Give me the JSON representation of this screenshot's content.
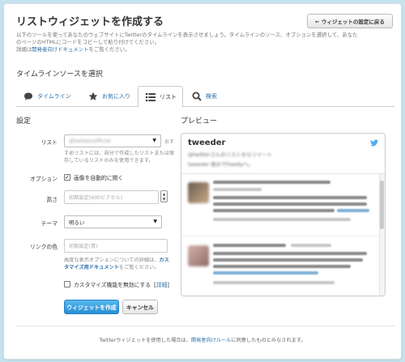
{
  "header": {
    "title": "リストウィジェットを作成する",
    "back_button_label": "← ウィジェットの設定に戻る"
  },
  "intro": {
    "line1": "以下のツールを使ってあなたのウェブサイトにTwitterのタイムラインを表示させましょう。タイムラインのソース、オプションを選択して、あなた",
    "line2": "のページのHTMLにコードをコピーして貼り付けてください。",
    "line3_prefix": "詳細は",
    "line3_link": "開発者向けドキュメント",
    "line3_suffix": "をご覧ください。"
  },
  "source_section_title": "タイムラインソースを選択",
  "tabs": [
    {
      "label": "タイムライン",
      "icon": "speech-bubble-icon"
    },
    {
      "label": "お気に入り",
      "icon": "star-icon"
    },
    {
      "label": "リスト",
      "icon": "list-icon",
      "active": true
    },
    {
      "label": "検索",
      "icon": "search-icon"
    }
  ],
  "settings": {
    "title": "設定",
    "list_label": "リスト",
    "list_value": "@twitter/official",
    "list_suffix": "おす",
    "list_help_line1": "すめリストには、自分で作成したリストまたは保",
    "list_help_line2": "存しているリストのみを使用できます。",
    "options_label": "オプション",
    "auto_expand_label": "画像を自動的に開く",
    "height_label": "高さ",
    "height_placeholder": "初期設定(600ピクセル)",
    "theme_label": "テーマ",
    "theme_value": "明るい",
    "link_color_label": "リンクの色",
    "link_color_placeholder": "初期設定(青)",
    "advanced_help_prefix": "高度な表示オプションについての詳細は、",
    "advanced_help_link1": "カス",
    "advanced_help_link2": "タマイズ用ドキュメント",
    "advanced_help_suffix": "をご覧ください。",
    "customize_label": "カスタマイズ機能を無効にする",
    "details_link": "詳細",
    "create_button": "ウィジェットを作成",
    "cancel_button": "キャンセル"
  },
  "preview": {
    "title": "プレビュー",
    "widget_title": "tweeder",
    "widget_subtitle": "@twitterさんのリストからツイート",
    "widget_description": "tweeder 他のでFeedlyへ。"
  },
  "footer": {
    "prefix": "Twitterウィジェットを使用した場合は、",
    "link": "開発者向けルール",
    "suffix": "に同意したものとみなされます。"
  },
  "colors": {
    "accent_blue": "#2a6fa8",
    "primary_button": "#2a8ed4",
    "background": "#c6e2ee"
  }
}
